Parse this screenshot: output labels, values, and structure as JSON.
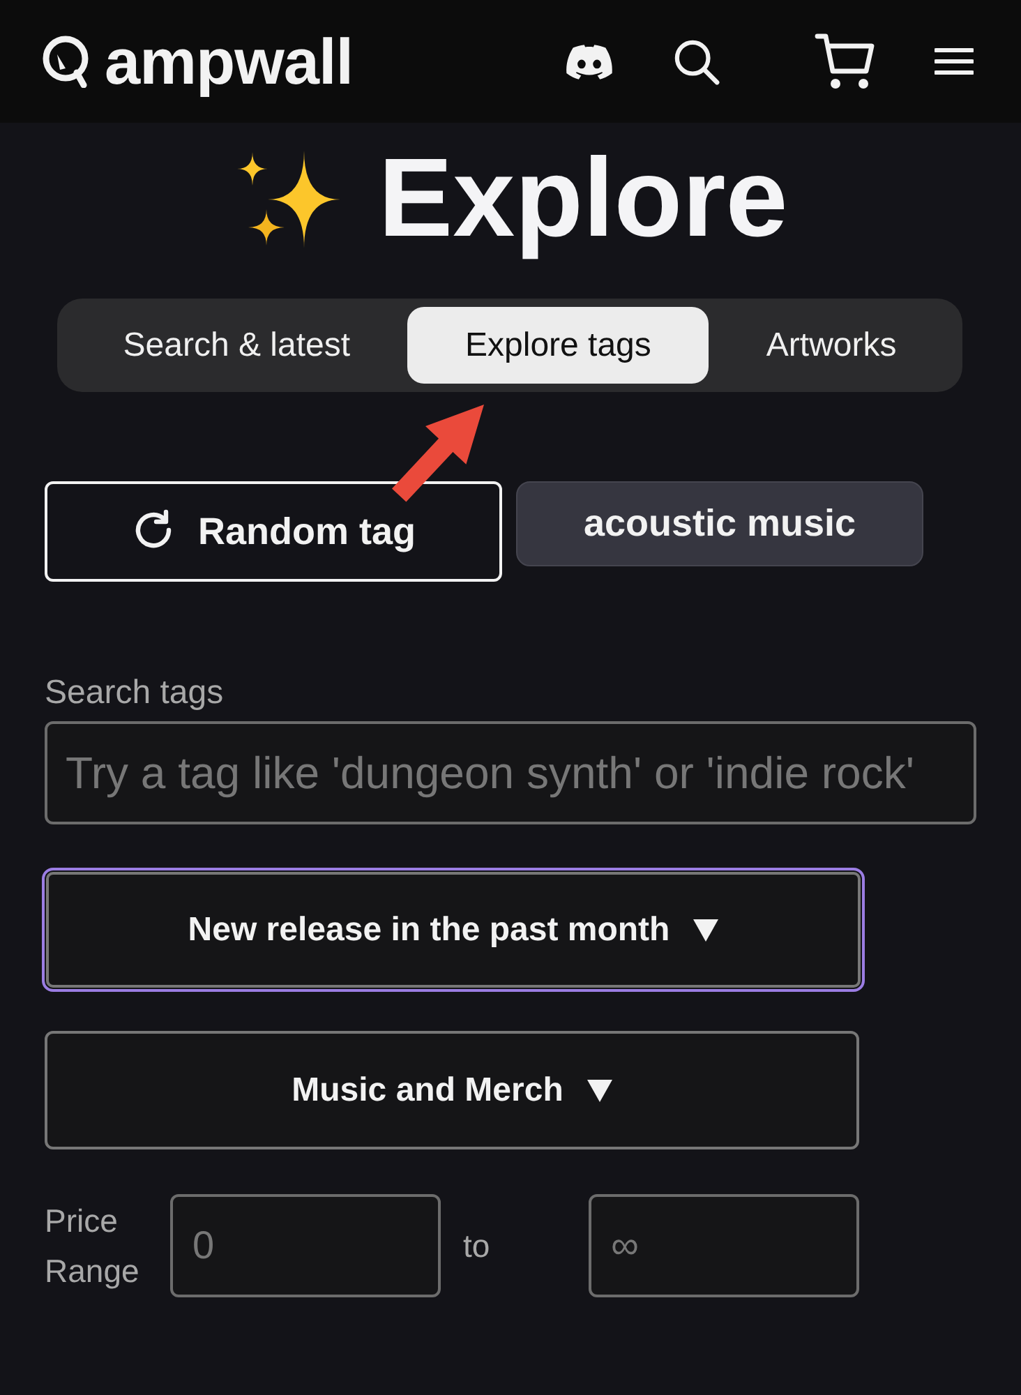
{
  "header": {
    "logo": "ampwall"
  },
  "title": "Explore",
  "tabs": [
    {
      "label": "Search & latest",
      "selected": false
    },
    {
      "label": "Explore tags",
      "selected": true
    },
    {
      "label": "Artworks",
      "selected": false
    }
  ],
  "random_button": {
    "label": "Random tag"
  },
  "current_tag": {
    "label": "acoustic music"
  },
  "tag_search": {
    "label": "Search tags",
    "placeholder": "Try a tag like 'dungeon synth' or 'indie rock'"
  },
  "filters": [
    {
      "value": "New release in the past month",
      "focused": true
    },
    {
      "value": "Music and Merch",
      "focused": false
    }
  ],
  "price_range": {
    "label": "Price Range",
    "min_placeholder": "0",
    "separator": "to",
    "max_placeholder": "∞"
  }
}
